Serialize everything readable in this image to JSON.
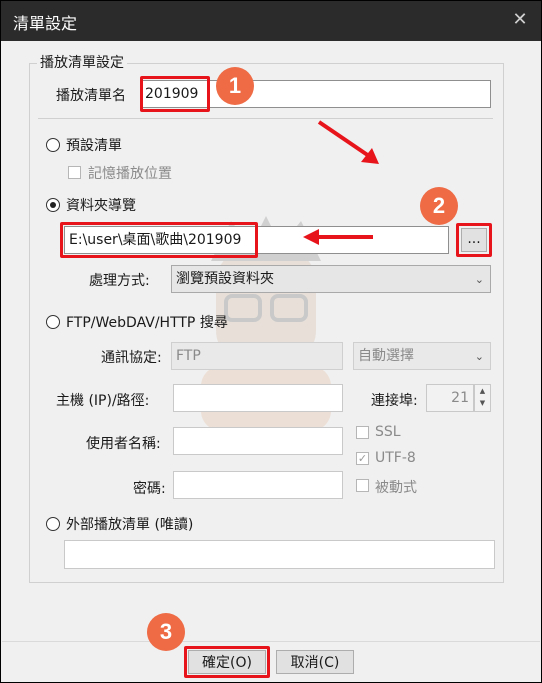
{
  "window": {
    "title": "清單設定",
    "close_glyph": "✕"
  },
  "group_title": "播放清單設定",
  "playlist_name": {
    "label": "播放清單名",
    "value": "201909"
  },
  "default_list": {
    "label": "預設清單",
    "remember_label": "記憶播放位置"
  },
  "folder_nav": {
    "label": "資料夾導覽",
    "path_value": "E:\\user\\桌面\\歌曲\\201909",
    "browse_label": "...",
    "process_label": "處理方式:",
    "process_value": "瀏覽預設資料夾"
  },
  "ftp": {
    "label": "FTP/WebDAV/HTTP 搜尋",
    "protocol_label": "通訊協定:",
    "protocol_value": "FTP",
    "auto_value": "自動選擇",
    "host_label": "主機 (IP)/路徑:",
    "port_label": "連接埠:",
    "port_value": "21",
    "user_label": "使用者名稱:",
    "password_label": "密碼:",
    "ssl_label": "SSL",
    "utf8_label": "UTF-8",
    "passive_label": "被動式"
  },
  "external": {
    "label": "外部播放清單 (唯讀)"
  },
  "footer": {
    "ok_label": "確定(O)",
    "cancel_label": "取消(C)"
  },
  "annotations": {
    "badge1": "1",
    "badge2": "2",
    "badge3": "3",
    "highlight_color": "#e8141b",
    "badge_color": "#ee6b45"
  }
}
